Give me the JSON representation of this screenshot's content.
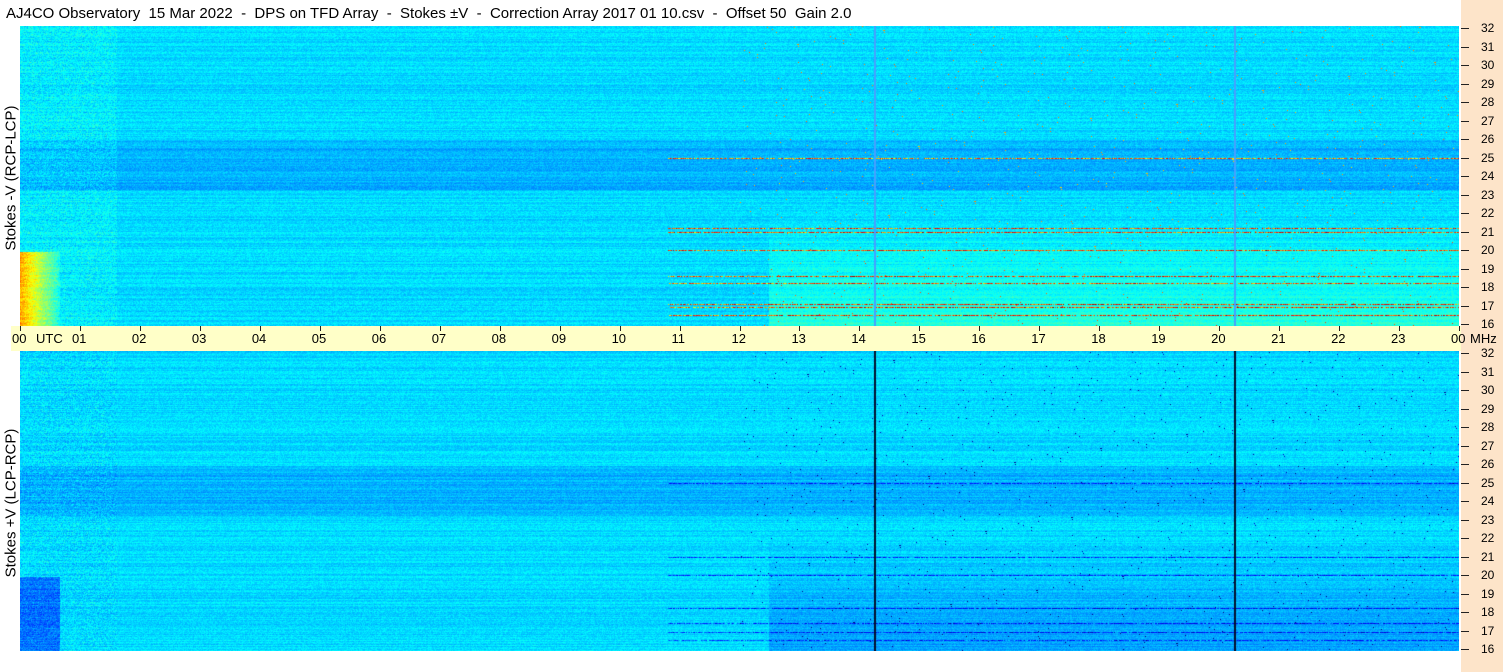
{
  "title": "AJ4CO Observatory  15 Mar 2022  -  DPS on TFD Array  -  Stokes ±V  -  Correction Array 2017 01 10.csv  -  Offset 50  Gain 2.0",
  "chart_data": {
    "type": "heatmap",
    "x_axis": {
      "unit_label": "UTC",
      "tick_labels": [
        "00",
        "01",
        "02",
        "03",
        "04",
        "05",
        "06",
        "07",
        "08",
        "09",
        "10",
        "11",
        "12",
        "13",
        "14",
        "15",
        "16",
        "17",
        "18",
        "19",
        "20",
        "21",
        "22",
        "23",
        "00"
      ],
      "range_hours": [
        0,
        24
      ]
    },
    "y_axis": {
      "unit_label": "MHz",
      "tick_labels": [
        "32",
        "31",
        "30",
        "29",
        "28",
        "27",
        "26",
        "25",
        "24",
        "23",
        "22",
        "21",
        "20",
        "19",
        "18",
        "17",
        "16"
      ],
      "range_mhz": [
        16,
        32
      ]
    },
    "panels": [
      {
        "label": "Stokes -V (RCP-LCP)",
        "colormap": "jet",
        "vertical_lines_utc": [
          14.25,
          20.25
        ],
        "vertical_line_color": "#3fa0ff",
        "strong_emission_bands_mhz": [
          16.5,
          16.9,
          17.1,
          18.2,
          18.6,
          20.0,
          21.0,
          21.2,
          25.0
        ]
      },
      {
        "label": "Stokes +V (LCP-RCP)",
        "colormap": "jet",
        "vertical_lines_utc": [
          14.25,
          20.25
        ],
        "vertical_line_color": "#02102e",
        "strong_emission_bands_mhz": [
          16.5,
          16.9,
          17.4,
          18.2,
          20.0,
          21.0,
          25.0
        ]
      }
    ]
  },
  "colors": {
    "background": "#ffffff",
    "utc_bar": "#ffffc8",
    "freq_strip": "#fde4c9",
    "base_blue": "#1e6fe0"
  }
}
